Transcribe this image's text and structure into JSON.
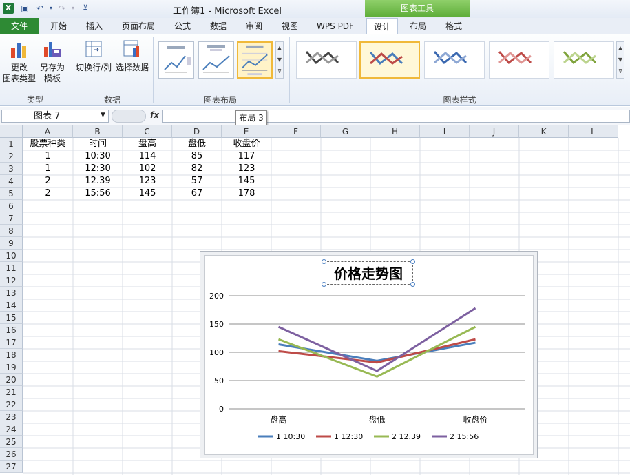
{
  "window": {
    "title": "工作簿1  -  Microsoft Excel",
    "app_icon": "X",
    "chart_tools_label": "图表工具"
  },
  "tabs": {
    "file": "文件",
    "home": "开始",
    "insert": "插入",
    "page_layout": "页面布局",
    "formulas": "公式",
    "data": "数据",
    "review": "审阅",
    "view": "视图",
    "wps_pdf": "WPS PDF",
    "design": "设计",
    "layout": "布局",
    "format": "格式"
  },
  "ribbon": {
    "change_type_line1": "更改",
    "change_type_line2": "图表类型",
    "save_template_line1": "另存为",
    "save_template_line2": "模板",
    "switch_row_col": "切换行/列",
    "select_data": "选择数据",
    "group_type": "类型",
    "group_data": "数据",
    "group_layouts": "图表布局",
    "group_styles": "图表样式"
  },
  "formula_bar": {
    "name_box": "图表 7",
    "fx": "fx",
    "formula": ""
  },
  "tooltip": "布局 3",
  "columns": [
    "A",
    "B",
    "C",
    "D",
    "E",
    "F",
    "G",
    "H",
    "I",
    "J",
    "K",
    "L"
  ],
  "rows": [
    "1",
    "2",
    "3",
    "4",
    "5",
    "6",
    "7",
    "8",
    "9",
    "10",
    "11",
    "12",
    "13",
    "14",
    "15",
    "16",
    "17",
    "18",
    "19",
    "20",
    "21",
    "22",
    "23",
    "24",
    "25",
    "26",
    "27"
  ],
  "sheet": {
    "r1": [
      "股票种类",
      "时间",
      "盘高",
      "盘低",
      "收盘价"
    ],
    "r2": [
      "1",
      "10:30",
      "114",
      "85",
      "117"
    ],
    "r3": [
      "1",
      "12:30",
      "102",
      "82",
      "123"
    ],
    "r4": [
      "2",
      "12.39",
      "123",
      "57",
      "145"
    ],
    "r5": [
      "2",
      "15:56",
      "145",
      "67",
      "178"
    ]
  },
  "chart_data": {
    "type": "line",
    "title": "价格走势图",
    "categories": [
      "盘高",
      "盘低",
      "收盘价"
    ],
    "ylim": [
      0,
      200
    ],
    "yticks": [
      "0",
      "50",
      "100",
      "150",
      "200"
    ],
    "grid": true,
    "legend": "bottom",
    "series": [
      {
        "name": "1 10:30",
        "values": [
          114,
          85,
          117
        ],
        "color": "#4a7ebb"
      },
      {
        "name": "1 12:30",
        "values": [
          102,
          82,
          123
        ],
        "color": "#be4b48"
      },
      {
        "name": "2 12.39",
        "values": [
          123,
          57,
          145
        ],
        "color": "#98b954"
      },
      {
        "name": "2 15:56",
        "values": [
          145,
          67,
          178
        ],
        "color": "#7d60a0"
      }
    ]
  }
}
